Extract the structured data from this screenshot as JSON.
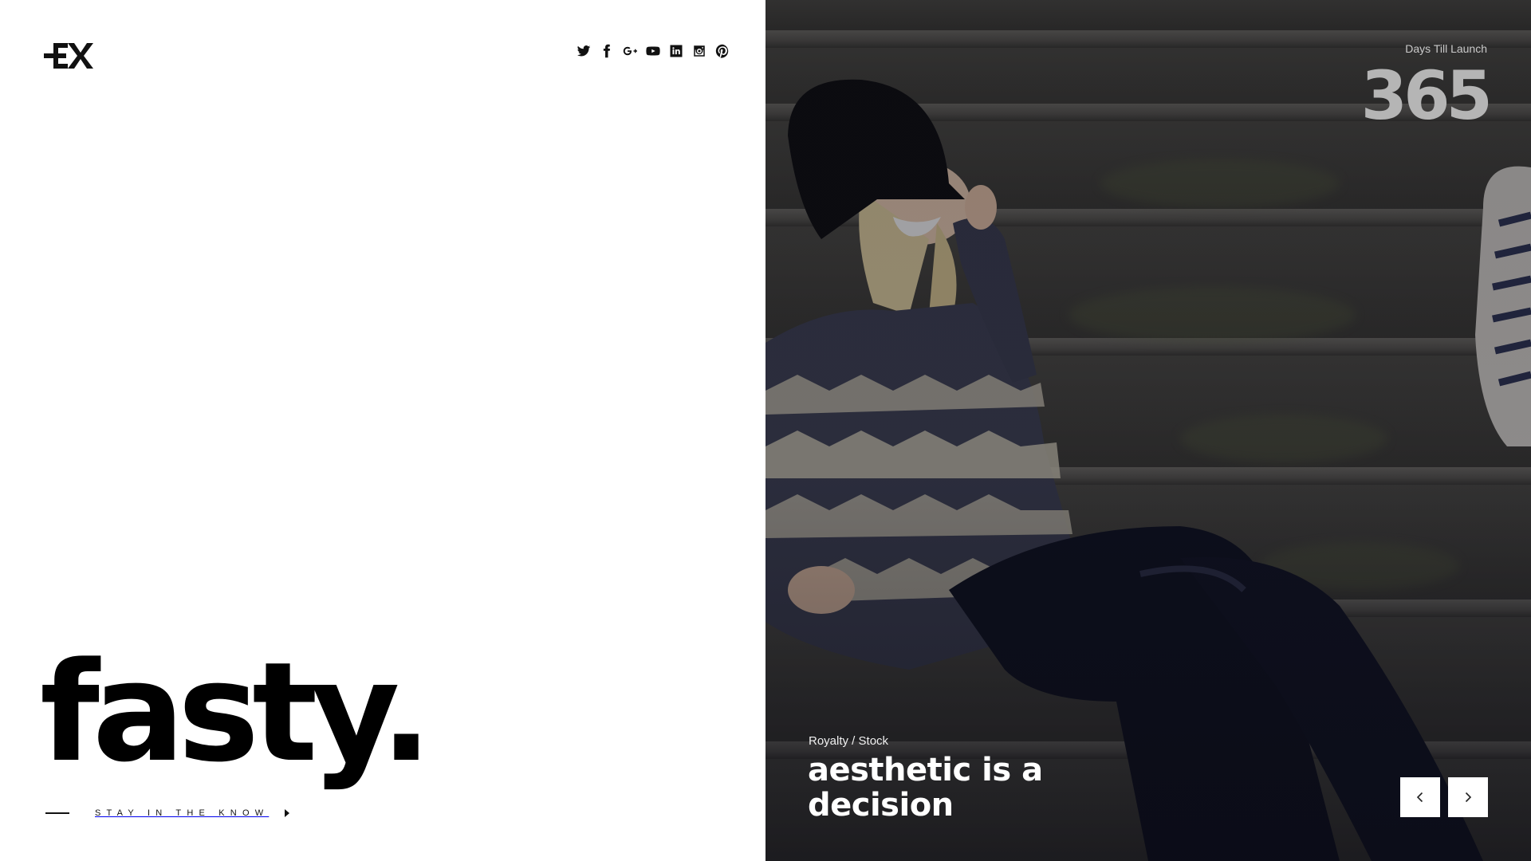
{
  "brand": {
    "logo_icon": "ex-monogram-logo",
    "wordmark": "fasty."
  },
  "social": [
    {
      "name": "twitter-icon"
    },
    {
      "name": "facebook-icon"
    },
    {
      "name": "google-plus-icon"
    },
    {
      "name": "youtube-icon"
    },
    {
      "name": "linkedin-icon"
    },
    {
      "name": "instagram-icon"
    },
    {
      "name": "pinterest-icon"
    }
  ],
  "cta": {
    "label": "STAY IN THE KNOW",
    "icon": "caret-right-icon"
  },
  "countdown": {
    "label": "Days Till Launch",
    "value": "365"
  },
  "slide": {
    "category": "Royalty / Stock",
    "title": "aesthetic is a decision",
    "prev_icon": "chevron-left-icon",
    "next_icon": "chevron-right-icon"
  },
  "colors": {
    "background": "#ffffff",
    "text": "#000000",
    "photo_overlay": "#0c0c12",
    "button_bg": "#ffffff"
  }
}
